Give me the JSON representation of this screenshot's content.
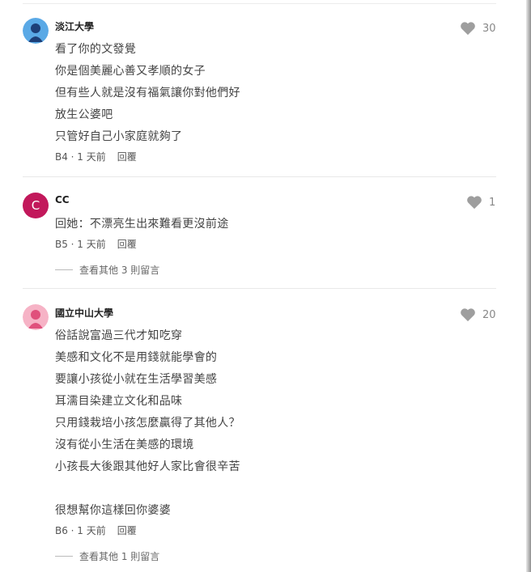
{
  "comments": [
    {
      "author": "淡江大學",
      "avatar": "blue-person-icon",
      "lines": [
        "看了你的文發覺",
        "你是個美麗心善又孝順的女子",
        "但有些人就是沒有福氣讓你對他們好",
        "放生公婆吧",
        "只管好自己小家庭就夠了"
      ],
      "meta": "B4 · 1 天前",
      "reply": "回覆",
      "likes": "30"
    },
    {
      "author": "CC",
      "avatar_letter": "C",
      "lines": [
        "回她：不漂亮生出來難看更沒前途"
      ],
      "meta": "B5 · 1 天前",
      "reply": "回覆",
      "likes": "1",
      "more_replies": "查看其他 3 則留言"
    },
    {
      "author": "國立中山大學",
      "avatar": "pink-person-icon",
      "lines": [
        "俗話說富過三代才知吃穿",
        "美感和文化不是用錢就能學會的",
        "要讓小孩從小就在生活學習美感",
        "耳濡目染建立文化和品味",
        "只用錢栽培小孩怎麼贏得了其他人？",
        "沒有從小生活在美感的環境",
        "小孩長大後跟其他好人家比會很辛苦",
        "",
        "很想幫你這樣回你婆婆"
      ],
      "meta": "B6 · 1 天前",
      "reply": "回覆",
      "likes": "20",
      "more_replies": "查看其他 1 則留言"
    }
  ],
  "colors": {
    "heart": "#9e9e9e",
    "letter_avatar": "#c2185b",
    "blue_avatar": "#5aa9e6",
    "pink_avatar": "#f6b3c6"
  }
}
